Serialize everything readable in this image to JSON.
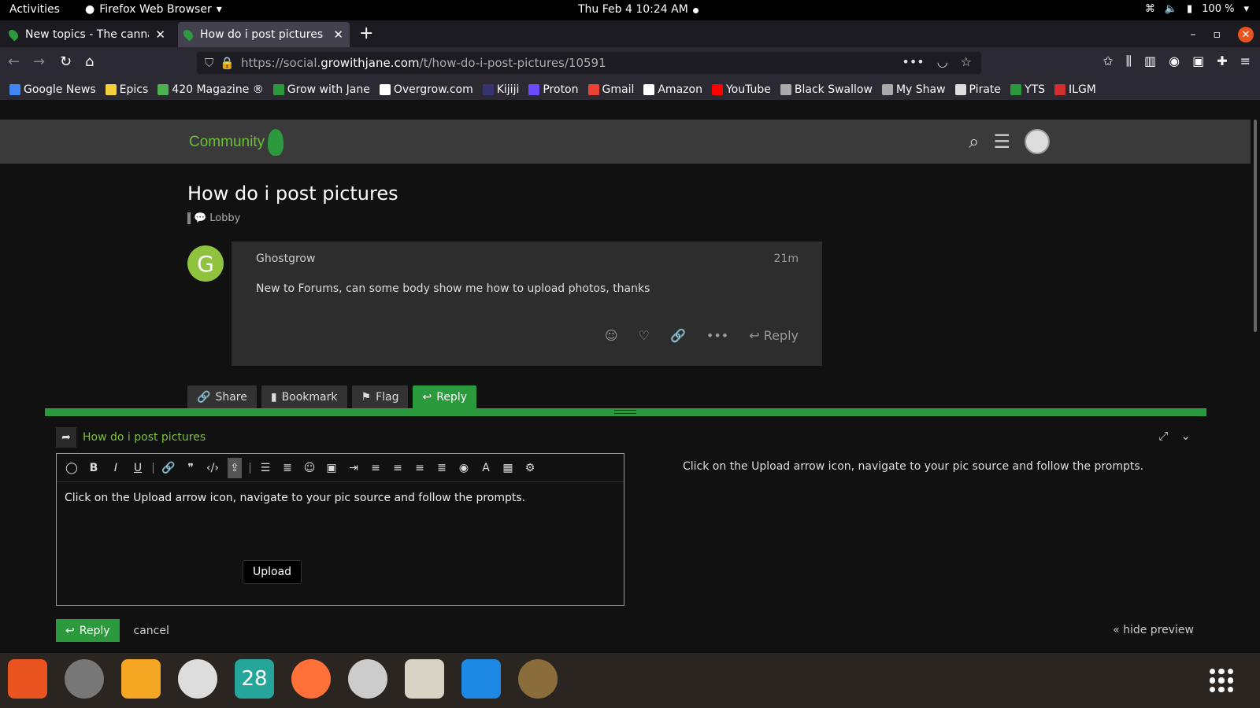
{
  "system": {
    "activities": "Activities",
    "app_name": "Firefox Web Browser",
    "clock": "Thu Feb 4  10:24 AM",
    "battery": "100 %"
  },
  "tabs": [
    {
      "label": "New topics - The cannab",
      "active": false
    },
    {
      "label": "How do i post pictures - ",
      "active": true
    }
  ],
  "url": {
    "prefix": "https://social.",
    "domain": "growithjane.com",
    "path": "/t/how-do-i-post-pictures/10591"
  },
  "bookmarks": [
    {
      "label": "Google News",
      "color": "#4285f4"
    },
    {
      "label": "Epics",
      "color": "#f4d03f"
    },
    {
      "label": "420 Magazine ®",
      "color": "#4caf50"
    },
    {
      "label": "Grow with Jane",
      "color": "#2c9a3c"
    },
    {
      "label": "Overgrow.com",
      "color": "#ffffff"
    },
    {
      "label": "Kijiji",
      "color": "#373373"
    },
    {
      "label": "Proton",
      "color": "#6d4aff"
    },
    {
      "label": "Gmail",
      "color": "#ea4335"
    },
    {
      "label": "Amazon",
      "color": "#ffffff"
    },
    {
      "label": "YouTube",
      "color": "#ff0000"
    },
    {
      "label": "Black Swallow",
      "color": "#aaaaaa"
    },
    {
      "label": "My Shaw",
      "color": "#aaaaaa"
    },
    {
      "label": "Pirate",
      "color": "#dddddd"
    },
    {
      "label": "YTS",
      "color": "#2c9a3c"
    },
    {
      "label": "ILGM",
      "color": "#d32f2f"
    }
  ],
  "site": {
    "logo_text": "Community"
  },
  "topic": {
    "title": "How do i post pictures",
    "category": "Lobby"
  },
  "post": {
    "avatar_letter": "G",
    "author": "Ghostgrow",
    "time": "21m",
    "body": "New to Forums, can some body show me how to upload photos, thanks",
    "reply_label": "Reply"
  },
  "topic_buttons": {
    "share": "Share",
    "bookmark": "Bookmark",
    "flag": "Flag",
    "reply": "Reply"
  },
  "composer": {
    "reply_to": "How do i post pictures",
    "editor_text": "Click on the Upload arrow icon, navigate to your pic source and follow the prompts.",
    "preview_text": "Click on the Upload arrow icon, navigate to your pic source and follow the prompts.",
    "tooltip": "Upload",
    "reply_button": "Reply",
    "cancel": "cancel",
    "hide_preview": "« hide preview"
  },
  "dock": {
    "calendar_day": "28"
  }
}
